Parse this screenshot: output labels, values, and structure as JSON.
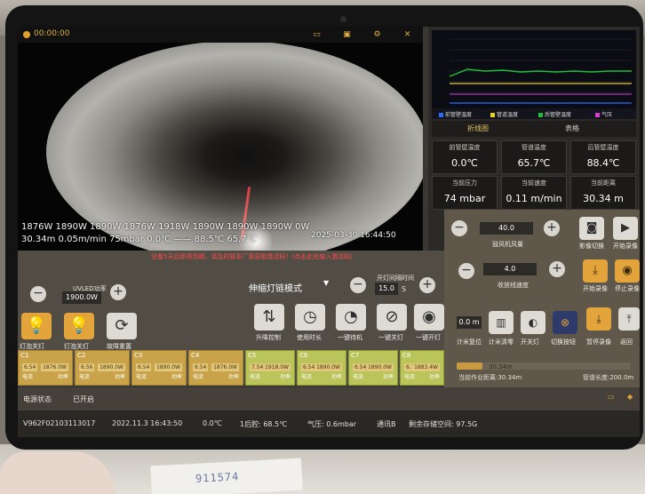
{
  "video": {
    "timer": "00:00:00",
    "overlay_line1": "1876W 1890W 1890W 1876W 1918W 1890W 1890W 1890W 0W",
    "overlay_line2": "30.34m 0.05m/min 75mbar   0.0℃   ——  88.5℃ 65.7℃",
    "datetime": "2025-03-30 16:44:50",
    "icons": [
      "folder-icon",
      "image-icon",
      "settings-icon",
      "close-icon"
    ]
  },
  "monitor": {
    "legend": [
      "前管壁温度",
      "管道温度",
      "后管壁温度",
      "气压"
    ],
    "legend_colors": [
      "#2a6cff",
      "#e8d020",
      "#1fbf3a",
      "#d83ad8"
    ],
    "tabs": [
      "折线图",
      "表格"
    ],
    "cells": [
      {
        "label": "前管壁温度",
        "value": "0.0℃"
      },
      {
        "label": "管道温度",
        "value": "65.7℃"
      },
      {
        "label": "后管壁温度",
        "value": "88.4℃"
      },
      {
        "label": "当前压力",
        "value": "74 mbar"
      },
      {
        "label": "当前速度",
        "value": "0.11 m/min"
      },
      {
        "label": "当前距离",
        "value": "30.34 m"
      }
    ]
  },
  "warning": "设备5天后即将到期，请及时联系厂家获取激活码！(点击此处输入激活码)",
  "uv_power": {
    "label": "UVLED功率",
    "value": "1900.0W"
  },
  "mode": {
    "label": "伸缩灯链模式"
  },
  "interval": {
    "label": "开灯间隔时间",
    "value": "15.0",
    "unit": "S"
  },
  "left_buttons": [
    "灯泡关灯",
    "灯泡关灯",
    "故障重置"
  ],
  "mid_buttons": [
    "升降控制",
    "使用时长",
    "一键待机",
    "一键关灯",
    "一键开灯"
  ],
  "lamps": [
    {
      "id": "C1",
      "v1": "6.54",
      "v2": "1876.0W",
      "l1": "电流",
      "l2": "功率",
      "active": false
    },
    {
      "id": "C2",
      "v1": "6.56",
      "v2": "1890.0W",
      "l1": "电流",
      "l2": "功率",
      "active": false
    },
    {
      "id": "C3",
      "v1": "6.54",
      "v2": "1890.0W",
      "l1": "电流",
      "l2": "功率",
      "active": false
    },
    {
      "id": "C4",
      "v1": "6.54",
      "v2": "1876.0W",
      "l1": "电流",
      "l2": "功率",
      "active": false
    },
    {
      "id": "C5",
      "v1": "7.54",
      "v2": "1918.0W",
      "l1": "电流",
      "l2": "功率",
      "active": true
    },
    {
      "id": "C6",
      "v1": "6.54",
      "v2": "1890.0W",
      "l1": "电流",
      "l2": "功率",
      "active": true
    },
    {
      "id": "C7",
      "v1": "6.54",
      "v2": "1890.0W",
      "l1": "电流",
      "l2": "功率",
      "active": true
    },
    {
      "id": "C8",
      "v1": "6.74",
      "v2": "1883.4W",
      "l1": "电流",
      "l2": "功率",
      "active": true
    }
  ],
  "right_ctrl": {
    "fan": {
      "value": "40.0",
      "label": "鼓风机风量"
    },
    "wire": {
      "value": "4.0",
      "label": "收放线速度"
    },
    "buttons": [
      "影像切换",
      "开始录像",
      "开始录像",
      "停止录像"
    ],
    "row3": [
      "计米复位",
      "计米清零",
      "开关灯",
      "切换按钮",
      "暂停录像",
      "返回"
    ],
    "meter_value": "0.0 m",
    "progress_value": "30.34m",
    "progress_pct": 15,
    "current_dist": "当前作业距离:30.34m",
    "total_dist": "管道长度:200.0m"
  },
  "status_bar": {
    "power": "电源状态",
    "power_state": "已开启",
    "device": "V962F02103113017",
    "datetime": "2022.11.3 16:43:50",
    "temp1": "0.0℃",
    "temp2": "1后腔: 68.5℃",
    "pressure": "气压: 0.6mbar",
    "comm": "通讯B",
    "storage": "剩余存储空间: 97.5G"
  },
  "paper_text": "911574"
}
